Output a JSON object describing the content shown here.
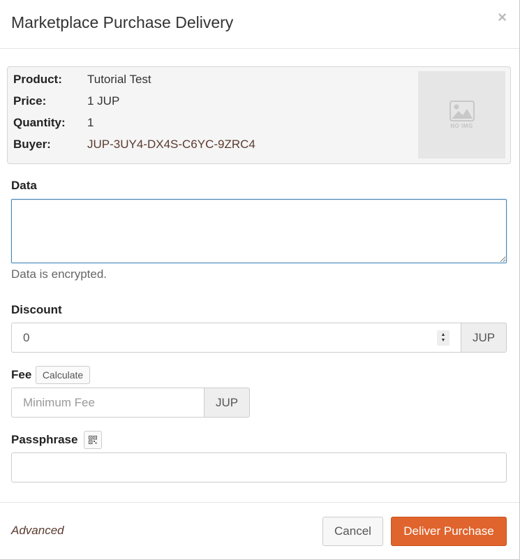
{
  "modal": {
    "title": "Marketplace Purchase Delivery",
    "close_symbol": "×"
  },
  "product_info": {
    "product_label": "Product:",
    "product_value": "Tutorial Test",
    "price_label": "Price:",
    "price_value": "1 JUP",
    "quantity_label": "Quantity:",
    "quantity_value": "1",
    "buyer_label": "Buyer:",
    "buyer_value": "JUP-3UY4-DX4S-C6YC-9ZRC4",
    "image_placeholder_text": "NO IMG",
    "image_icon": "image-placeholder-icon"
  },
  "data_field": {
    "label": "Data",
    "value": "",
    "help_text": "Data is encrypted."
  },
  "discount_field": {
    "label": "Discount",
    "value": "0",
    "unit": "JUP"
  },
  "fee_field": {
    "label": "Fee",
    "calculate_button": "Calculate",
    "placeholder": "Minimum Fee",
    "unit": "JUP"
  },
  "passphrase_field": {
    "label": "Passphrase",
    "qr_icon": "qr-code-icon",
    "value": ""
  },
  "footer": {
    "advanced_link": "Advanced",
    "cancel_button": "Cancel",
    "submit_button": "Deliver Purchase"
  },
  "colors": {
    "primary": "#e0642d",
    "link": "#5a3a2e",
    "focus_border": "#4a86b4"
  }
}
